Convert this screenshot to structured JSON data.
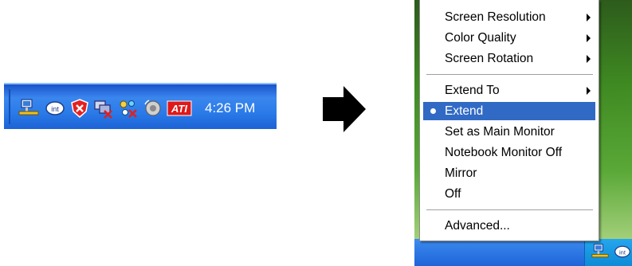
{
  "tray": {
    "icons": [
      "network-icon",
      "intel-graphics-icon",
      "security-shield-icon",
      "network-disconnected-icon",
      "network-error-icon",
      "volume-icon",
      "ati-icon"
    ],
    "ati_text": "ATI",
    "intel_text": "int",
    "clock": "4:26 PM"
  },
  "menu": {
    "items": [
      {
        "label": "Screen Resolution",
        "submenu": true
      },
      {
        "label": "Color Quality",
        "submenu": true
      },
      {
        "label": "Screen Rotation",
        "submenu": true
      },
      {
        "label": "Extend To",
        "submenu": true
      },
      {
        "label": "Extend",
        "selected": true
      },
      {
        "label": "Set as Main Monitor"
      },
      {
        "label": "Notebook Monitor Off"
      },
      {
        "label": "Mirror"
      },
      {
        "label": "Off"
      },
      {
        "label": "Advanced..."
      }
    ]
  },
  "colors": {
    "taskbar_blue": "#2a7ae8",
    "highlight": "#316ac5",
    "ati_red": "#e01818"
  }
}
